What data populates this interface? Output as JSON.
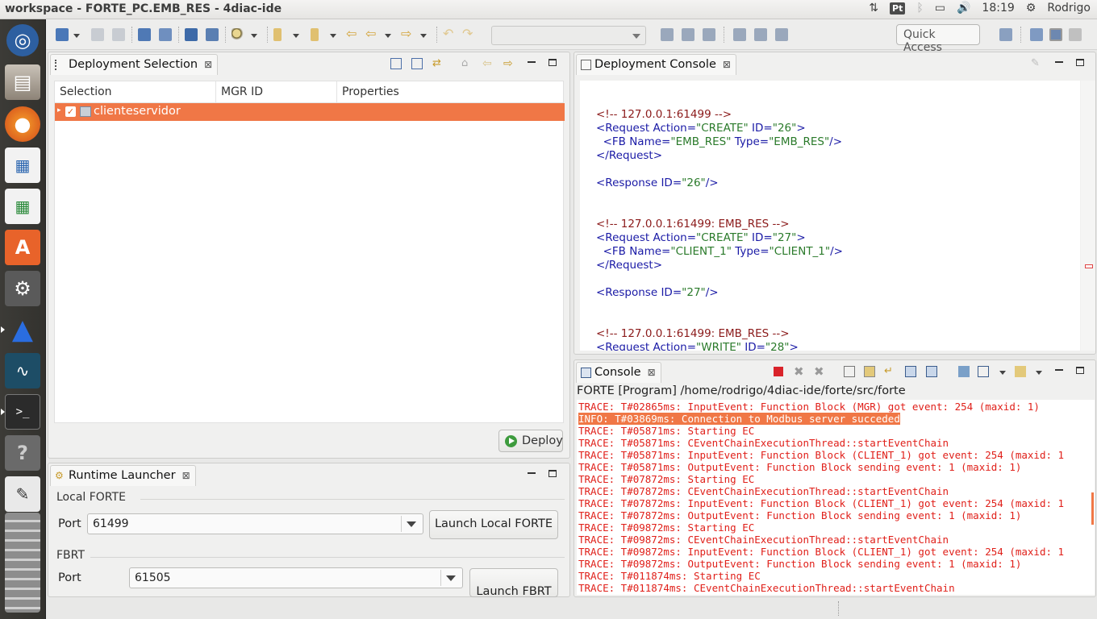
{
  "window": {
    "title": "workspace - FORTE_PC.EMB_RES - 4diac-ide"
  },
  "system_tray": {
    "keyboard_layout": "Pt",
    "time": "18:19",
    "user": "Rodrigo"
  },
  "launcher": {
    "items": [
      "ubuntu-dash-icon",
      "files-icon",
      "firefox-icon",
      "writer-icon",
      "calc-icon",
      "software-center-icon",
      "settings-icon",
      "4diac-icon",
      "scope-icon",
      "terminal-icon",
      "help-icon",
      "text-editor-icon",
      "workspaces-icon"
    ]
  },
  "toolbar": {
    "quick_access": "Quick Access"
  },
  "deployment_selection": {
    "tab_label": "Deployment Selection",
    "columns": [
      "Selection",
      "MGR ID",
      "Properties"
    ],
    "rows": [
      {
        "label": "clienteservidor",
        "checked": true
      }
    ],
    "deploy_label": "Deploy"
  },
  "runtime_launcher": {
    "tab_label": "Runtime Launcher",
    "local_forte": {
      "group_label": "Local FORTE",
      "port_label": "Port",
      "port_value": "61499",
      "launch_label": "Launch Local FORTE"
    },
    "fbrt": {
      "group_label": "FBRT",
      "port_label": "Port",
      "port_value": "61505",
      "launch_label": "Launch FBRT"
    }
  },
  "deployment_console": {
    "tab_label": "Deployment Console",
    "lines": [
      {
        "kind": "comment",
        "text": "<!-- 127.0.0.1:61499 -->"
      },
      {
        "kind": "request_open",
        "action": "CREATE",
        "id": "26"
      },
      {
        "kind": "fb",
        "name": "EMB_RES",
        "type": "EMB_RES"
      },
      {
        "kind": "request_close"
      },
      {
        "kind": "blank"
      },
      {
        "kind": "response",
        "id": "26"
      },
      {
        "kind": "blank"
      },
      {
        "kind": "blank"
      },
      {
        "kind": "comment",
        "text": "<!-- 127.0.0.1:61499: EMB_RES -->"
      },
      {
        "kind": "request_open",
        "action": "CREATE",
        "id": "27"
      },
      {
        "kind": "fb",
        "name": "CLIENT_1",
        "type": "CLIENT_1"
      },
      {
        "kind": "request_close"
      },
      {
        "kind": "blank"
      },
      {
        "kind": "response",
        "id": "27"
      },
      {
        "kind": "blank"
      },
      {
        "kind": "blank"
      },
      {
        "kind": "comment",
        "text": "<!-- 127.0.0.1:61499: EMB_RES -->"
      },
      {
        "kind": "request_open",
        "action": "WRITE",
        "id": "28"
      }
    ]
  },
  "console": {
    "tab_label": "Console",
    "process_path": "FORTE [Program] /home/rodrigo/4diac-ide/forte/src/forte",
    "lines": [
      "TRACE: T#02865ms: InputEvent: Function Block (MGR) got event: 254 (maxid: 1)",
      "INFO: T#03869ms: Connection to Modbus server succeded",
      "TRACE: T#05871ms: Starting EC",
      "TRACE: T#05871ms: CEventChainExecutionThread::startEventChain",
      "TRACE: T#05871ms: InputEvent: Function Block (CLIENT_1) got event: 254 (maxid: 1",
      "TRACE: T#05871ms: OutputEvent: Function Block sending event: 1 (maxid: 1)",
      "TRACE: T#07872ms: Starting EC",
      "TRACE: T#07872ms: CEventChainExecutionThread::startEventChain",
      "TRACE: T#07872ms: InputEvent: Function Block (CLIENT_1) got event: 254 (maxid: 1",
      "TRACE: T#07872ms: OutputEvent: Function Block sending event: 1 (maxid: 1)",
      "TRACE: T#09872ms: Starting EC",
      "TRACE: T#09872ms: CEventChainExecutionThread::startEventChain",
      "TRACE: T#09872ms: InputEvent: Function Block (CLIENT_1) got event: 254 (maxid: 1",
      "TRACE: T#09872ms: OutputEvent: Function Block sending event: 1 (maxid: 1)",
      "TRACE: T#011874ms: Starting EC",
      "TRACE: T#011874ms: CEventChainExecutionThread::startEventChain"
    ],
    "highlighted_line": 1
  },
  "colors": {
    "selection": "#f07746",
    "trace_text": "#e0201a",
    "launcher_bg": "#3c3b37"
  }
}
